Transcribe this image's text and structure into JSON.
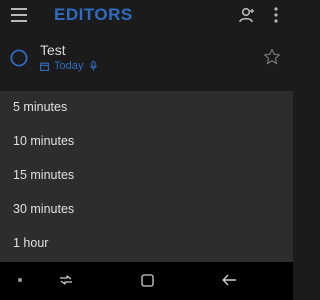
{
  "app_bar": {
    "title": "EDITORS",
    "menu_icon": "hamburger-menu-icon",
    "account_icon": "person-add-icon",
    "overflow_icon": "more-vert-icon"
  },
  "task": {
    "title": "Test",
    "due": "Today",
    "check_icon": "circle-outline-icon",
    "calendar_icon": "calendar-icon",
    "reminder_icon": "microphone-icon",
    "star_icon": "star-outline-icon"
  },
  "reminder_sheet": {
    "options": [
      {
        "label": "5 minutes"
      },
      {
        "label": "10 minutes"
      },
      {
        "label": "15 minutes"
      },
      {
        "label": "30 minutes"
      },
      {
        "label": "1 hour"
      }
    ]
  },
  "nav_bar": {
    "dot_icon": "dot-icon",
    "recent_icon": "recent-apps-icon",
    "home_icon": "home-icon",
    "back_icon": "back-arrow-icon"
  },
  "colors": {
    "accent": "#2f6cbf",
    "background": "#1b1b1b",
    "sheet": "#2d2d2d",
    "nav_bar": "#000000"
  }
}
